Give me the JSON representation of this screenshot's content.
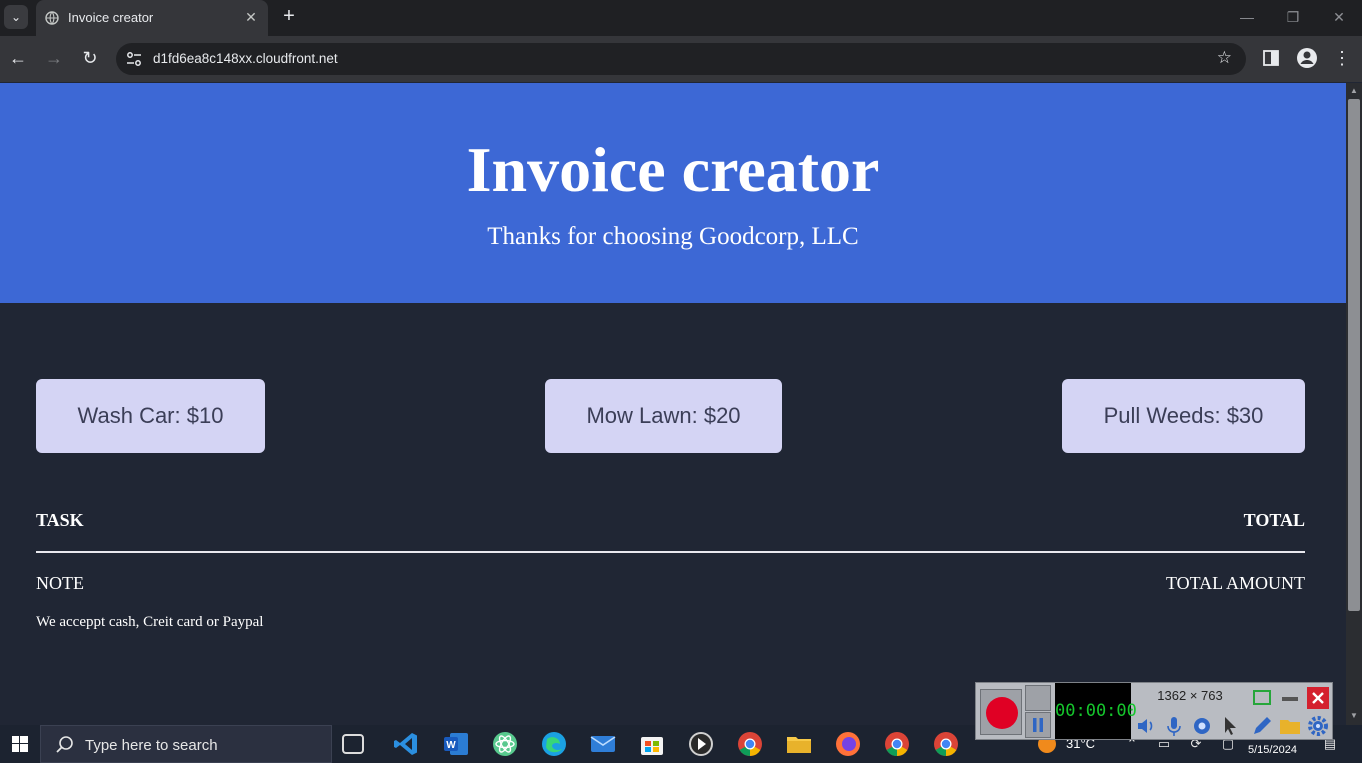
{
  "browser": {
    "tab_title": "Invoice creator",
    "url": "d1fd6ea8c148xx.cloudfront.net"
  },
  "page": {
    "title": "Invoice creator",
    "subtitle": "Thanks for choosing Goodcorp, LLC",
    "services": [
      {
        "label": "Wash Car: $10"
      },
      {
        "label": "Mow Lawn: $20"
      },
      {
        "label": "Pull Weeds: $30"
      }
    ],
    "table": {
      "task_header": "TASK",
      "total_header": "TOTAL",
      "note_label": "NOTE",
      "total_amount_label": "TOTAL AMOUNT",
      "payment_note": "We acceppt cash, Creit card or Paypal"
    },
    "colors": {
      "hero": "#3d68d5",
      "background": "#202634",
      "button": "#d4d4f4",
      "button_text": "#3b3e57"
    }
  },
  "taskbar": {
    "search_placeholder": "Type here to search",
    "temperature": "31°C",
    "date": "5/15/2024",
    "apps": [
      "task-view-icon",
      "vscode-icon",
      "word-icon",
      "atom-icon",
      "edge-icon",
      "mail-icon",
      "store-icon",
      "media-player-icon",
      "chrome-icon",
      "file-explorer-icon",
      "firefox-icon",
      "chrome-profile-icon",
      "chrome-alt-icon"
    ]
  },
  "recorder": {
    "timer": "00:00:00",
    "dimensions": "1362 × 763"
  }
}
